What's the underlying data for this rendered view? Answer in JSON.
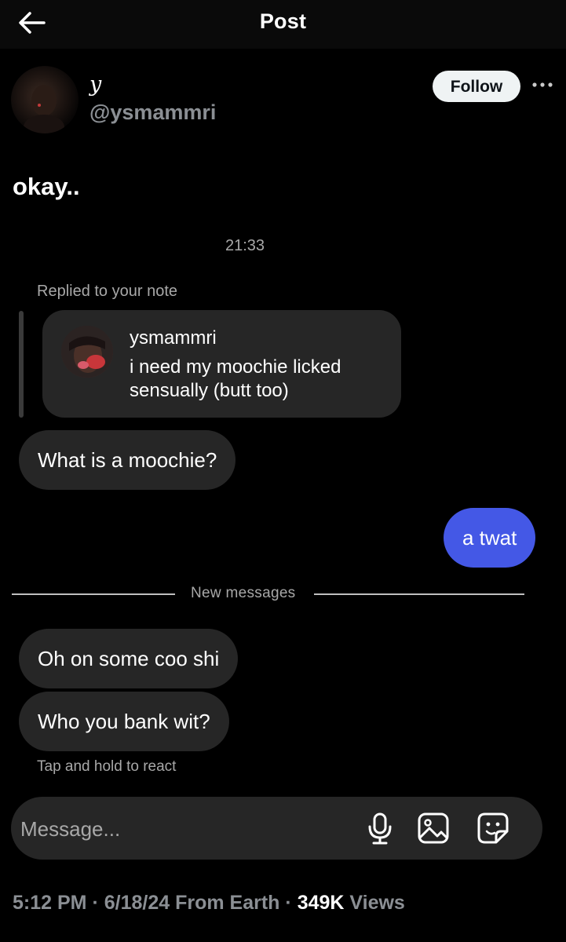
{
  "header": {
    "title": "Post",
    "back_icon": "arrow-left-icon"
  },
  "author": {
    "display_name": "y",
    "handle": "@ysmammri",
    "follow_label": "Follow",
    "more_icon": "more-horizontal-icon"
  },
  "tweet": {
    "text": "okay.."
  },
  "dm": {
    "timestamp": "21:33",
    "replied_label": "Replied to your note",
    "note": {
      "username": "ysmammri",
      "text": "i need my moochie licked sensually (butt too)"
    },
    "messages_before": [
      {
        "text": "What is a moochie?",
        "from": "them"
      },
      {
        "text": "a twat",
        "from": "me"
      }
    ],
    "divider_label": "New messages",
    "messages_after": [
      {
        "text": "Oh on some coo shi",
        "from": "them"
      },
      {
        "text": "Who you bank wit?",
        "from": "them"
      }
    ],
    "hint": "Tap and hold to react",
    "composer": {
      "placeholder": "Message...",
      "icons": [
        "microphone-icon",
        "image-icon",
        "sticker-icon"
      ]
    },
    "colors": {
      "my_bubble": "#4458e6",
      "their_bubble": "#262626"
    }
  },
  "footer": {
    "time": "5:12 PM",
    "date": "6/18/24",
    "source": "From Earth",
    "views_count": "349K",
    "views_label": "Views"
  }
}
